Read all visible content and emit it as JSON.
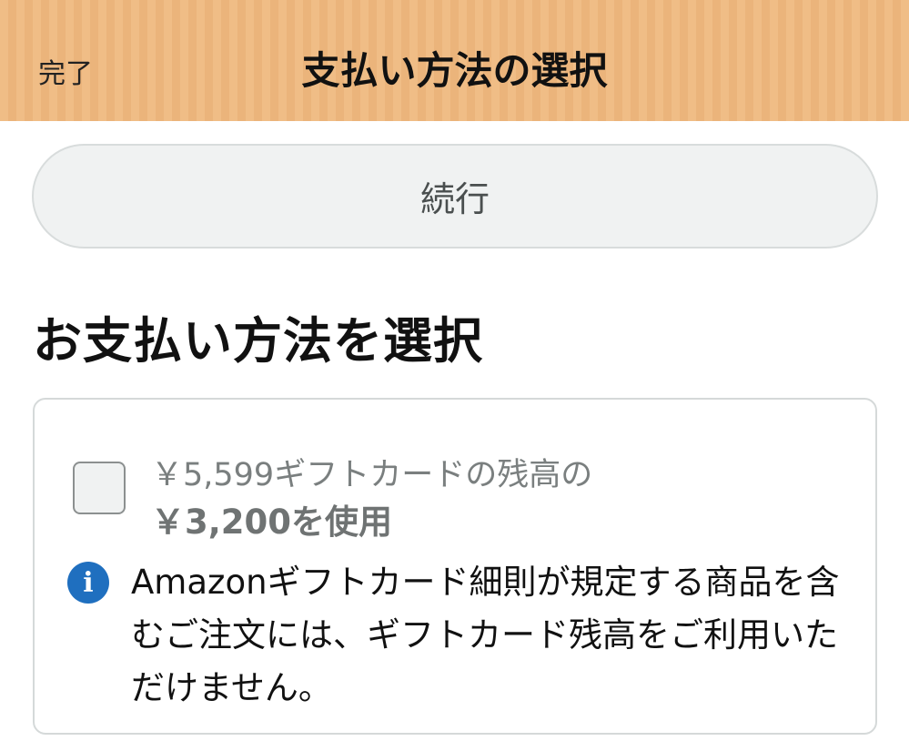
{
  "header": {
    "done_label": "完了",
    "title": "支払い方法の選択",
    "accent_color": "#f0bd86"
  },
  "actions": {
    "continue_label": "続行"
  },
  "main": {
    "section_title": "お支払い方法を選択",
    "gift_card": {
      "checked": false,
      "line1": "￥5,599ギフトカードの残高の",
      "line2": "￥3,200を使用",
      "info_icon": "info-icon",
      "info_symbol": "i",
      "notice": "Amazonギフトカード細則が規定する商品を含むご注文には、ギフトカード残高をご利用いただけません。"
    }
  }
}
